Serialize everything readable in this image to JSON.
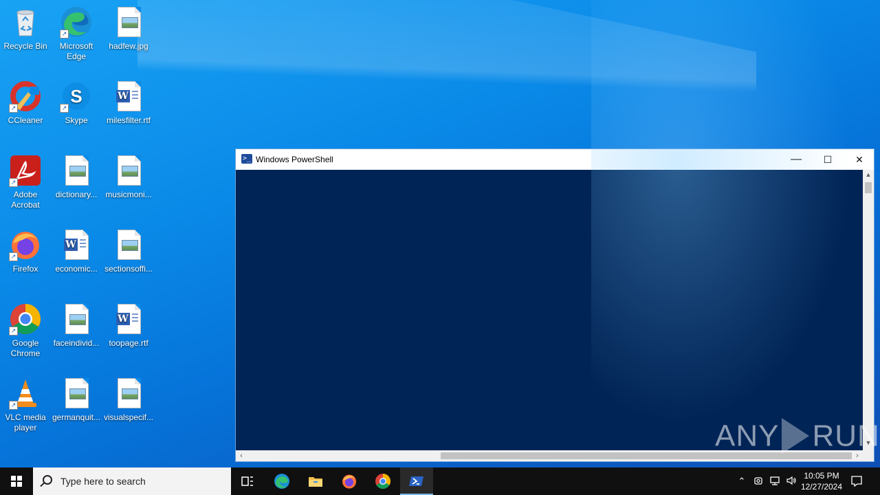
{
  "desktop": {
    "icons": [
      {
        "label": "Recycle Bin"
      },
      {
        "label": "Microsoft Edge"
      },
      {
        "label": "hadfew.jpg"
      },
      {
        "label": "CCleaner"
      },
      {
        "label": "Skype"
      },
      {
        "label": "milesfilter.rtf"
      },
      {
        "label": "Adobe Acrobat"
      },
      {
        "label": "dictionary..."
      },
      {
        "label": "musicmoni..."
      },
      {
        "label": "Firefox"
      },
      {
        "label": "economic..."
      },
      {
        "label": "sectionsoffi..."
      },
      {
        "label": "Google Chrome"
      },
      {
        "label": "faceindivid..."
      },
      {
        "label": "toopage.rtf"
      },
      {
        "label": "VLC media player"
      },
      {
        "label": "germanquit..."
      },
      {
        "label": "visualspecif..."
      }
    ]
  },
  "window": {
    "title": "Windows PowerShell",
    "minimize_glyph": "—",
    "maximize_glyph": "☐",
    "close_glyph": "✕",
    "console_bg": "#012456"
  },
  "watermark": {
    "left": "ANY",
    "right": "RUN"
  },
  "taskbar": {
    "search_placeholder": "Type here to search",
    "pinned": [
      "task-view",
      "edge",
      "file-explorer",
      "firefox",
      "chrome",
      "powershell"
    ],
    "clock_time": "10:05 PM",
    "clock_date": "12/27/2024"
  }
}
